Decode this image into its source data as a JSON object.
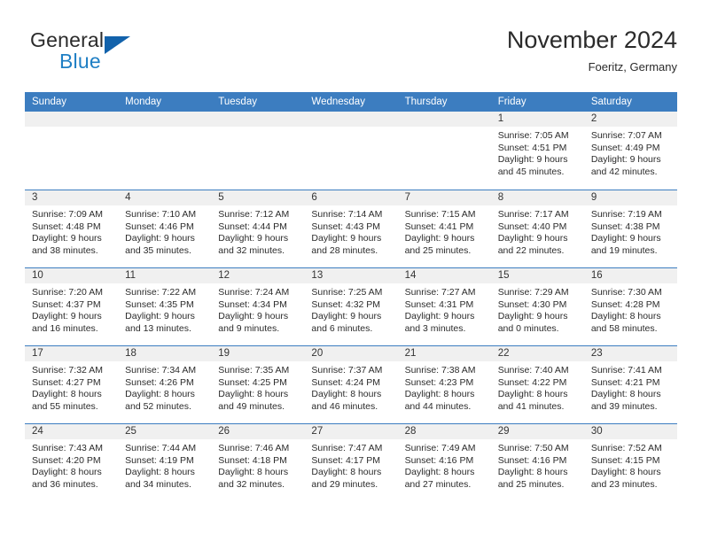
{
  "brand": {
    "name_top": "General",
    "name_bottom": "Blue",
    "accent_color": "#1262ab",
    "text_color": "#2b2b2b"
  },
  "header": {
    "title": "November 2024",
    "subtitle": "Foeritz, Germany"
  },
  "theme": {
    "header_blue": "#3c7dc0",
    "daynum_band": "#f0f0f0"
  },
  "weekdays": [
    "Sunday",
    "Monday",
    "Tuesday",
    "Wednesday",
    "Thursday",
    "Friday",
    "Saturday"
  ],
  "weeks": [
    [
      {
        "day": "",
        "empty": true
      },
      {
        "day": "",
        "empty": true
      },
      {
        "day": "",
        "empty": true
      },
      {
        "day": "",
        "empty": true
      },
      {
        "day": "",
        "empty": true
      },
      {
        "day": "1",
        "sunrise": "Sunrise: 7:05 AM",
        "sunset": "Sunset: 4:51 PM",
        "daylight1": "Daylight: 9 hours",
        "daylight2": "and 45 minutes."
      },
      {
        "day": "2",
        "sunrise": "Sunrise: 7:07 AM",
        "sunset": "Sunset: 4:49 PM",
        "daylight1": "Daylight: 9 hours",
        "daylight2": "and 42 minutes."
      }
    ],
    [
      {
        "day": "3",
        "sunrise": "Sunrise: 7:09 AM",
        "sunset": "Sunset: 4:48 PM",
        "daylight1": "Daylight: 9 hours",
        "daylight2": "and 38 minutes."
      },
      {
        "day": "4",
        "sunrise": "Sunrise: 7:10 AM",
        "sunset": "Sunset: 4:46 PM",
        "daylight1": "Daylight: 9 hours",
        "daylight2": "and 35 minutes."
      },
      {
        "day": "5",
        "sunrise": "Sunrise: 7:12 AM",
        "sunset": "Sunset: 4:44 PM",
        "daylight1": "Daylight: 9 hours",
        "daylight2": "and 32 minutes."
      },
      {
        "day": "6",
        "sunrise": "Sunrise: 7:14 AM",
        "sunset": "Sunset: 4:43 PM",
        "daylight1": "Daylight: 9 hours",
        "daylight2": "and 28 minutes."
      },
      {
        "day": "7",
        "sunrise": "Sunrise: 7:15 AM",
        "sunset": "Sunset: 4:41 PM",
        "daylight1": "Daylight: 9 hours",
        "daylight2": "and 25 minutes."
      },
      {
        "day": "8",
        "sunrise": "Sunrise: 7:17 AM",
        "sunset": "Sunset: 4:40 PM",
        "daylight1": "Daylight: 9 hours",
        "daylight2": "and 22 minutes."
      },
      {
        "day": "9",
        "sunrise": "Sunrise: 7:19 AM",
        "sunset": "Sunset: 4:38 PM",
        "daylight1": "Daylight: 9 hours",
        "daylight2": "and 19 minutes."
      }
    ],
    [
      {
        "day": "10",
        "sunrise": "Sunrise: 7:20 AM",
        "sunset": "Sunset: 4:37 PM",
        "daylight1": "Daylight: 9 hours",
        "daylight2": "and 16 minutes."
      },
      {
        "day": "11",
        "sunrise": "Sunrise: 7:22 AM",
        "sunset": "Sunset: 4:35 PM",
        "daylight1": "Daylight: 9 hours",
        "daylight2": "and 13 minutes."
      },
      {
        "day": "12",
        "sunrise": "Sunrise: 7:24 AM",
        "sunset": "Sunset: 4:34 PM",
        "daylight1": "Daylight: 9 hours",
        "daylight2": "and 9 minutes."
      },
      {
        "day": "13",
        "sunrise": "Sunrise: 7:25 AM",
        "sunset": "Sunset: 4:32 PM",
        "daylight1": "Daylight: 9 hours",
        "daylight2": "and 6 minutes."
      },
      {
        "day": "14",
        "sunrise": "Sunrise: 7:27 AM",
        "sunset": "Sunset: 4:31 PM",
        "daylight1": "Daylight: 9 hours",
        "daylight2": "and 3 minutes."
      },
      {
        "day": "15",
        "sunrise": "Sunrise: 7:29 AM",
        "sunset": "Sunset: 4:30 PM",
        "daylight1": "Daylight: 9 hours",
        "daylight2": "and 0 minutes."
      },
      {
        "day": "16",
        "sunrise": "Sunrise: 7:30 AM",
        "sunset": "Sunset: 4:28 PM",
        "daylight1": "Daylight: 8 hours",
        "daylight2": "and 58 minutes."
      }
    ],
    [
      {
        "day": "17",
        "sunrise": "Sunrise: 7:32 AM",
        "sunset": "Sunset: 4:27 PM",
        "daylight1": "Daylight: 8 hours",
        "daylight2": "and 55 minutes."
      },
      {
        "day": "18",
        "sunrise": "Sunrise: 7:34 AM",
        "sunset": "Sunset: 4:26 PM",
        "daylight1": "Daylight: 8 hours",
        "daylight2": "and 52 minutes."
      },
      {
        "day": "19",
        "sunrise": "Sunrise: 7:35 AM",
        "sunset": "Sunset: 4:25 PM",
        "daylight1": "Daylight: 8 hours",
        "daylight2": "and 49 minutes."
      },
      {
        "day": "20",
        "sunrise": "Sunrise: 7:37 AM",
        "sunset": "Sunset: 4:24 PM",
        "daylight1": "Daylight: 8 hours",
        "daylight2": "and 46 minutes."
      },
      {
        "day": "21",
        "sunrise": "Sunrise: 7:38 AM",
        "sunset": "Sunset: 4:23 PM",
        "daylight1": "Daylight: 8 hours",
        "daylight2": "and 44 minutes."
      },
      {
        "day": "22",
        "sunrise": "Sunrise: 7:40 AM",
        "sunset": "Sunset: 4:22 PM",
        "daylight1": "Daylight: 8 hours",
        "daylight2": "and 41 minutes."
      },
      {
        "day": "23",
        "sunrise": "Sunrise: 7:41 AM",
        "sunset": "Sunset: 4:21 PM",
        "daylight1": "Daylight: 8 hours",
        "daylight2": "and 39 minutes."
      }
    ],
    [
      {
        "day": "24",
        "sunrise": "Sunrise: 7:43 AM",
        "sunset": "Sunset: 4:20 PM",
        "daylight1": "Daylight: 8 hours",
        "daylight2": "and 36 minutes."
      },
      {
        "day": "25",
        "sunrise": "Sunrise: 7:44 AM",
        "sunset": "Sunset: 4:19 PM",
        "daylight1": "Daylight: 8 hours",
        "daylight2": "and 34 minutes."
      },
      {
        "day": "26",
        "sunrise": "Sunrise: 7:46 AM",
        "sunset": "Sunset: 4:18 PM",
        "daylight1": "Daylight: 8 hours",
        "daylight2": "and 32 minutes."
      },
      {
        "day": "27",
        "sunrise": "Sunrise: 7:47 AM",
        "sunset": "Sunset: 4:17 PM",
        "daylight1": "Daylight: 8 hours",
        "daylight2": "and 29 minutes."
      },
      {
        "day": "28",
        "sunrise": "Sunrise: 7:49 AM",
        "sunset": "Sunset: 4:16 PM",
        "daylight1": "Daylight: 8 hours",
        "daylight2": "and 27 minutes."
      },
      {
        "day": "29",
        "sunrise": "Sunrise: 7:50 AM",
        "sunset": "Sunset: 4:16 PM",
        "daylight1": "Daylight: 8 hours",
        "daylight2": "and 25 minutes."
      },
      {
        "day": "30",
        "sunrise": "Sunrise: 7:52 AM",
        "sunset": "Sunset: 4:15 PM",
        "daylight1": "Daylight: 8 hours",
        "daylight2": "and 23 minutes."
      }
    ]
  ]
}
